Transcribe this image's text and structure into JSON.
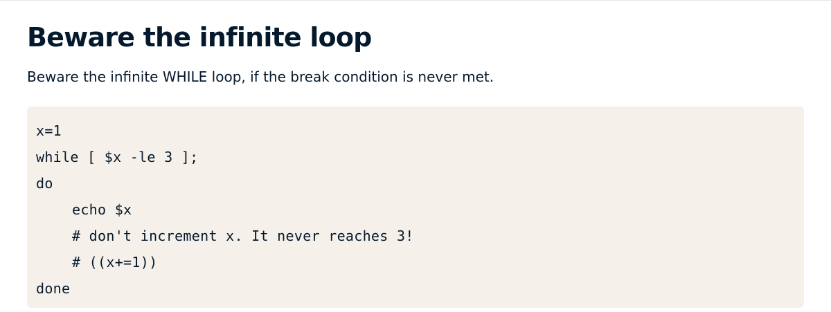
{
  "article": {
    "title": "Beware the infinite loop",
    "intro": "Beware the infinite WHILE loop, if the break condition is never met."
  },
  "code": {
    "lines": [
      "x=1",
      "while [ $x -le 3 ];",
      "do",
      "echo $x",
      "# don't increment x. It never reaches 3!",
      "# ((x+=1))",
      "done"
    ]
  },
  "colors": {
    "text": "#05192d",
    "code_background": "#f5f1ea",
    "page_background": "#ffffff"
  }
}
